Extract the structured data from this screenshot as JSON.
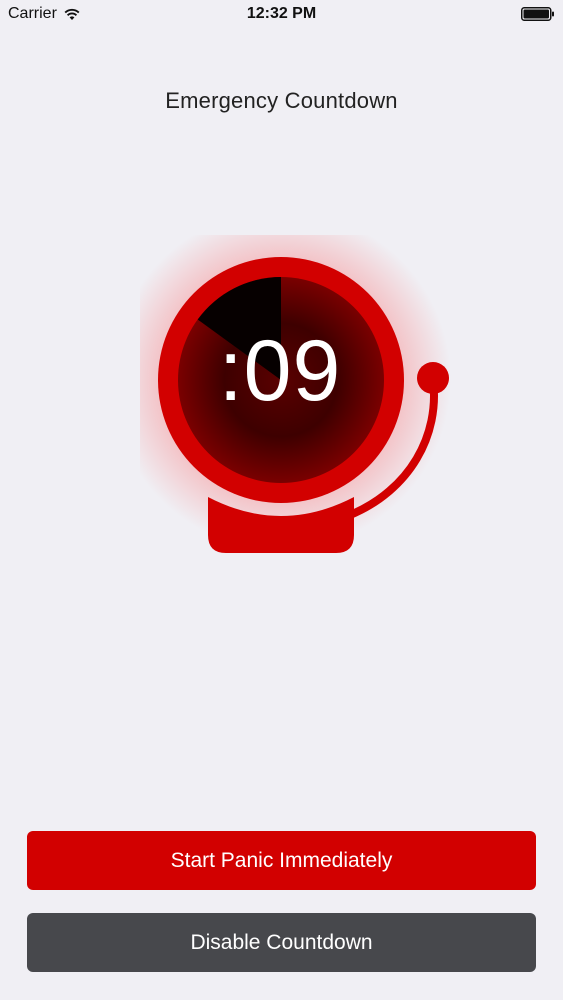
{
  "status_bar": {
    "carrier": "Carrier",
    "time": "12:32 PM",
    "icons": [
      "wifi-icon",
      "battery-icon"
    ]
  },
  "header": {
    "title": "Emergency Countdown"
  },
  "timer": {
    "display": ":09",
    "remaining_fraction": 0.9,
    "icon": "alarm-bell-icon"
  },
  "actions": {
    "panic_label": "Start Panic Immediately",
    "disable_label": "Disable Countdown"
  },
  "colors": {
    "background": "#f0eff4",
    "bell_red": "#d20000",
    "panic_button": "#d20000",
    "disable_button": "#47484c",
    "text": "#222222"
  }
}
